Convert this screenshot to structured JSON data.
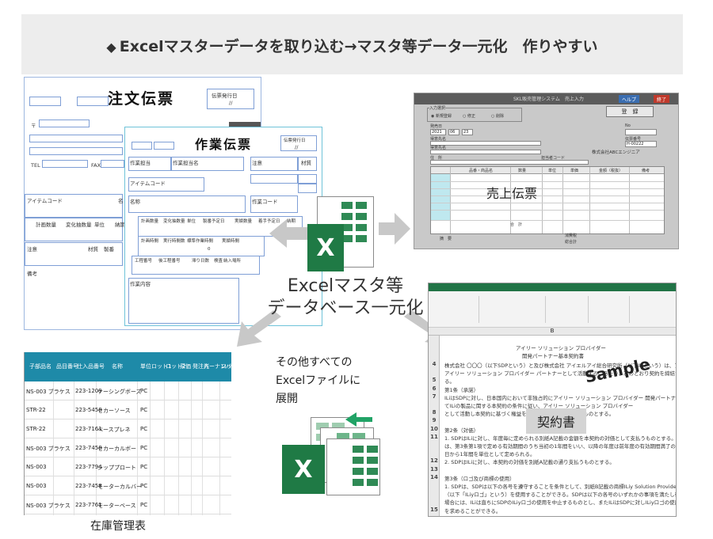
{
  "banner": {
    "prefix": "◆",
    "title": "Excelマスターデータを取り込む→マスタ等データ一元化　作りやすい"
  },
  "order_slip": {
    "title": "注文伝票",
    "date_label": "伝票発行日",
    "date_sep": "//",
    "zip_mark": "〒",
    "tel": "TEL",
    "fax": "FAX",
    "item_code": "アイテムコード",
    "name_short": "名",
    "cols": [
      "計画数量",
      "変化抽数量",
      "単位",
      "納期"
    ],
    "note": "注意",
    "material": "材質",
    "manufacture": "製番",
    "remarks": "備考"
  },
  "work_slip": {
    "title": "作業伝票",
    "date_label": "伝票発行日",
    "date_sep": "//",
    "worker": "作業担当",
    "worker_name": "作業担当名",
    "note": "注意",
    "material": "材質",
    "item_code": "アイテムコード",
    "name": "名称",
    "work_code": "作業コード",
    "row1": [
      "計画数量",
      "変化抽数量",
      "単位",
      "製番予定日",
      "実績数量",
      "着手予定日",
      "納期"
    ],
    "row2": [
      "計画時間",
      "実行時間数",
      "標準作業時間",
      "実績時間"
    ],
    "zero": "0",
    "row3": [
      "工程番号",
      "後工程番号",
      "滞り日数",
      "検査",
      "納入場所"
    ],
    "contents": "作業内容"
  },
  "sales_window": {
    "title": "SKL販売管理システム　売上入力",
    "btn_help": "ヘルプ",
    "btn_end": "終了",
    "section": "入力選択",
    "radio": [
      "新規登録",
      "修正",
      "削除"
    ],
    "register": "登　録",
    "date_label": "発売日",
    "date_values": [
      "2021",
      "06",
      "23"
    ],
    "customer_code": "得意先名",
    "customer_name": "得意先名",
    "address": "住　所",
    "person_code": "担当者コード",
    "no": "No",
    "company": "株式会社ABCエンジニア",
    "slip_no_label": "伝票番号",
    "slip_no": "H-00222",
    "grid_head": [
      "品番・商品名",
      "数量",
      "単位",
      "単価",
      "金額（税抜）",
      "備考"
    ],
    "total": "合　計",
    "tax": "消費税",
    "grand": "総合計",
    "memo": "摘　要",
    "overlay_label": "売上伝票"
  },
  "center": {
    "xl_letter": "X",
    "line1": "Excelマスタ等",
    "line2": "データベース一元化"
  },
  "inventory": {
    "headers": [
      "子部品名",
      "品目番号",
      "仕入品番号",
      "名称",
      "単位",
      "ロット1",
      "ロット2",
      "原価",
      "発注先",
      "バーナンバー",
      "ロット"
    ],
    "rows": [
      [
        "NS-003 ブラケス",
        "223-1209",
        "ケーシングボーズ",
        "PC"
      ],
      [
        "STR-22",
        "223-5458",
        "セカーソース",
        "PC"
      ],
      [
        "STR-22",
        "223-7161",
        "ベースプレネ",
        "PC"
      ],
      [
        "NS-003 ブラケス",
        "223-7458",
        "セカーカルボー",
        "PC"
      ],
      [
        "NS-003",
        "223-7794",
        "シッププロート",
        "PC"
      ],
      [
        "NS-003",
        "223-7458",
        "モーターカルバー",
        "PC"
      ],
      [
        "NS-003 ブラケス",
        "223-7761",
        "モーターベース",
        "PC"
      ]
    ],
    "caption": "在庫管理表"
  },
  "expand": {
    "line1": "その他すべての",
    "line2": "Excelファイルに",
    "line3": "展開"
  },
  "contract": {
    "col_b": "B",
    "title1": "アイリー ソリューション プロバイダー",
    "title2": "開発パートナー基本契約書",
    "rows": [
      {
        "n": "4",
        "t": "株式会社 〇〇〇（以下SDPという）と及び株式会社 アイエルアイ総合研究所（以下ILiという）は、アイ"
      },
      {
        "n": "",
        "t": "アイリー ソリューション プロバイダー パートナーとして活動するにあたり、次のとおり契約を締結す"
      },
      {
        "n": "5",
        "t": "る。"
      },
      {
        "n": "6",
        "t": "第1条（承諾）"
      },
      {
        "n": "7",
        "t": "ILiはSDPに対し、日本国内において非独占的にアイリー ソリューション プロバイダー 開発パートナーとし"
      },
      {
        "n": "",
        "t": "てILiの製品に関する本契約の条件に従い、アイリー ソリューション プロバイダー"
      },
      {
        "n": "8",
        "t": "として活動し本契約に基づく権益を享受することを承諾するものとする。"
      },
      {
        "n": "9",
        "t": ""
      },
      {
        "n": "10",
        "t": "第2条（対価）"
      },
      {
        "n": "11",
        "t": "1. SDPはILiに対し、年度毎に定められる別紙A記載の金額を本契約の対価として支払うものとする。初年度"
      },
      {
        "n": "",
        "t": "は、第3条第1項で定める有効期間のうち当初の1年間をいい、以降の年度は前年度の有効期間満了の翌"
      },
      {
        "n": "",
        "t": "日から1年間を単位として定められる。"
      },
      {
        "n": "12",
        "t": "2. SDPはILiに対し、本契約の対価を別紙A記載の通り支払うものとする。"
      },
      {
        "n": "13",
        "t": ""
      },
      {
        "n": "14",
        "t": "第3条（ロゴ及び商標の使用）"
      },
      {
        "n": "",
        "t": "1. SDPは、SDPは以下の各号を遵守することを条件として、別紙B記載の商標ILiy Solution Providerのロゴ"
      },
      {
        "n": "",
        "t": "（以下「ILiyロゴ」という）を使用することができる。SDPは以下の各号のいずれかの事項を満たし得なくなった"
      },
      {
        "n": "",
        "t": "場合には、ILiは直ちにSDPのILiyロゴの使用を中止するものとし、またILiはSDPに対しILiyロゴの使用中止"
      },
      {
        "n": "15",
        "t": "を求めることができる。"
      }
    ],
    "sample": "Sample",
    "label": "契約書"
  }
}
